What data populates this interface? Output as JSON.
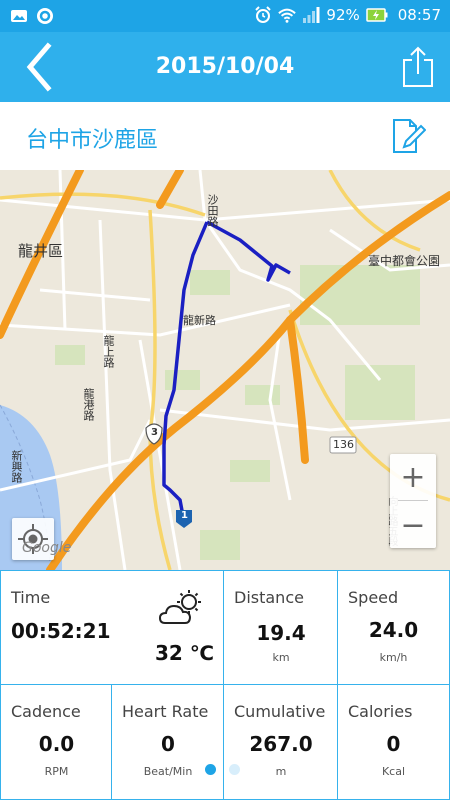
{
  "status_bar": {
    "battery": "92%",
    "time": "08:57"
  },
  "header": {
    "title": "2015/10/04"
  },
  "location": {
    "name": "台中市沙鹿區"
  },
  "map": {
    "labels": {
      "district": "龍井區",
      "park": "臺中都會公園",
      "road_shatian": "沙田路",
      "road_longxin": "龍新路",
      "road_longshang": "龍上路",
      "road_longgang": "龍港路",
      "road_138": "136",
      "road_3": "3",
      "road_1": "1",
      "road_side": "新興路",
      "road_xiang": "向上路五段"
    },
    "zoom_in": "+",
    "zoom_out": "−",
    "logo": "Google",
    "colors": {
      "route": "#1a1fc2",
      "highway": "#f39a1e",
      "river": "#a7c6f0",
      "park": "#cfe0b3"
    }
  },
  "stats": {
    "time": {
      "label": "Time",
      "value": "00:52:21",
      "temperature": "32 ℃"
    },
    "distance": {
      "label": "Distance",
      "value": "19.4",
      "unit": "km"
    },
    "speed": {
      "label": "Speed",
      "value": "24.0",
      "unit": "km/h"
    },
    "cadence": {
      "label": "Cadence",
      "value": "0.0",
      "unit": "RPM"
    },
    "heart_rate": {
      "label": "Heart Rate",
      "value": "0",
      "unit": "Beat/Min"
    },
    "cumulative": {
      "label": "Cumulative",
      "value": "267.0",
      "unit": "m"
    },
    "calories": {
      "label": "Calories",
      "value": "0",
      "unit": "Kcal"
    }
  },
  "pager": {
    "active_color": "#1ea4e6",
    "inactive_color": "#d8eefb"
  },
  "theme": {
    "accent": "#2fb0ec",
    "status_bar": "#1ea4e6",
    "border": "#36b2ec"
  }
}
